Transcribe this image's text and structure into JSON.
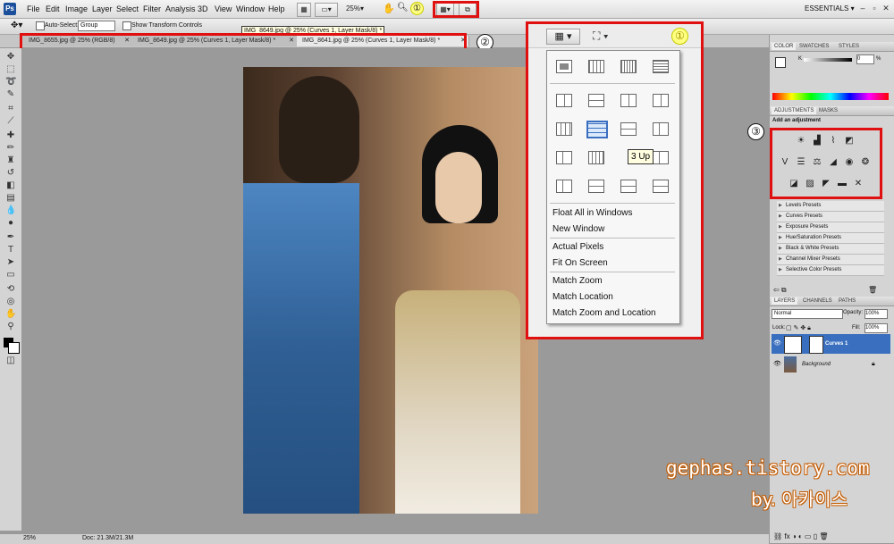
{
  "app": {
    "logo": "Ps"
  },
  "menubar": {
    "items": [
      "File",
      "Edit",
      "Image",
      "Layer",
      "Select",
      "Filter",
      "Analysis",
      "3D",
      "View",
      "Window",
      "Help"
    ],
    "zoom": "25%",
    "workspace": "ESSENTIALS"
  },
  "options": {
    "auto_select_label": "Auto-Select:",
    "auto_select_value": "Group",
    "show_transform_label": "Show Transform Controls",
    "tooltip_doc": "IMG_8649.jpg @ 25% (Curves 1, Layer Mask/8) *"
  },
  "tabs": [
    {
      "label": "IMG_8655.jpg @ 25% (RGB/8)",
      "active": false
    },
    {
      "label": "IMG_8649.jpg @ 25% (Curves 1, Layer Mask/8) *",
      "active": false
    },
    {
      "label": "IMG_8641.jpg @ 25% (Curves 1, Layer Mask/8) *",
      "active": true
    }
  ],
  "annotations": {
    "one": "①",
    "two": "②",
    "three": "③"
  },
  "arrange_menu": {
    "tooltip": "3 Up",
    "items": [
      "Float All in Windows",
      "New Window",
      "Actual Pixels",
      "Fit On Screen",
      "Match Zoom",
      "Match Location",
      "Match Zoom and Location"
    ]
  },
  "panels": {
    "color_tabs": [
      "COLOR",
      "SWATCHES",
      "STYLES"
    ],
    "color_k_label": "K",
    "color_k_value": "0",
    "color_k_unit": "%",
    "adjust_tabs": [
      "ADJUSTMENTS",
      "MASKS"
    ],
    "add_adjustment": "Add an adjustment",
    "presets": [
      "Levels Presets",
      "Curves Presets",
      "Exposure Presets",
      "Hue/Saturation Presets",
      "Black & White Presets",
      "Channel Mixer Presets",
      "Selective Color Presets"
    ],
    "layer_tabs": [
      "LAYERS",
      "CHANNELS",
      "PATHS"
    ],
    "blend_mode": "Normal",
    "opacity_label": "Opacity:",
    "opacity_value": "100%",
    "lock_label": "Lock:",
    "fill_label": "Fill:",
    "fill_value": "100%",
    "layers": [
      {
        "name": "Curves 1",
        "selected": true
      },
      {
        "name": "Background",
        "selected": false
      }
    ]
  },
  "status": {
    "zoom": "25%",
    "doc": "Doc: 21.3M/21.3M"
  },
  "watermark": {
    "site": "gephas.tistory.com",
    "by": "by. 아카이스"
  },
  "colors": {
    "accent": "#e01010",
    "selection": "#3a6fbf"
  }
}
